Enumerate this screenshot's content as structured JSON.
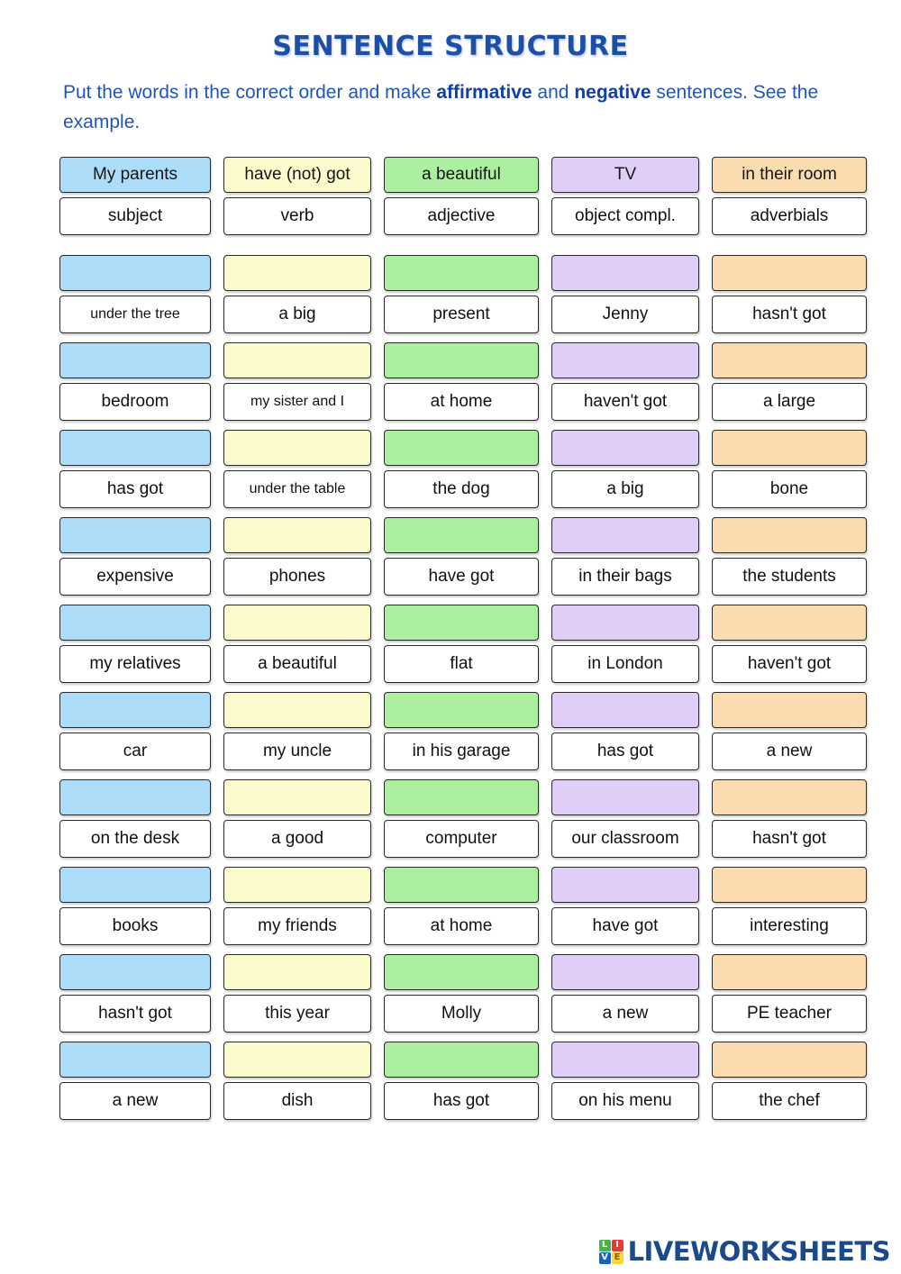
{
  "title": "SENTENCE STRUCTURE",
  "instructions": {
    "part1": "Put the words in the correct order and make ",
    "bold1": "affirmative",
    "part2": " and ",
    "bold2": "negative",
    "part3": " sentences.  See the example."
  },
  "colors": {
    "subject": "#ACDCF8",
    "verb": "#FBFBCD",
    "adjective": "#ACEFA0",
    "object": "#E0CEF8",
    "adverbial": "#FBDCB0",
    "title": "#1B4FA8",
    "instructions": "#1F55C0",
    "logo_text": "#1B4A8A"
  },
  "example_row": {
    "slots": [
      "My parents",
      "have (not) got",
      "a beautiful",
      "TV",
      "in their room"
    ],
    "labels": [
      "subject",
      "verb",
      "adjective",
      "object compl.",
      "adverbials"
    ]
  },
  "task_rows": [
    {
      "words": [
        "under the tree",
        "a big",
        "present",
        "Jenny",
        "hasn't got"
      ]
    },
    {
      "words": [
        "bedroom",
        "my sister and I",
        "at home",
        "haven't got",
        "a large"
      ]
    },
    {
      "words": [
        "has got",
        "under the table",
        "the dog",
        "a big",
        "bone"
      ]
    },
    {
      "words": [
        "expensive",
        "phones",
        "have got",
        "in their bags",
        "the students"
      ]
    },
    {
      "words": [
        "my relatives",
        "a beautiful",
        "flat",
        "in London",
        "haven't got"
      ]
    },
    {
      "words": [
        "car",
        "my uncle",
        "in his garage",
        "has got",
        "a new"
      ]
    },
    {
      "words": [
        "on the desk",
        "a good",
        "computer",
        "our classroom",
        "hasn't got"
      ]
    },
    {
      "words": [
        "books",
        "my friends",
        "at home",
        "have got",
        "interesting"
      ]
    },
    {
      "words": [
        "hasn't got",
        "this year",
        "Molly",
        "a new",
        "PE teacher"
      ]
    },
    {
      "words": [
        "a new",
        "dish",
        "has got",
        "on his menu",
        "the chef"
      ]
    }
  ],
  "footer": {
    "mark": [
      "L",
      "I",
      "V",
      "E"
    ],
    "brand": "LIVEWORKSHEETS"
  }
}
